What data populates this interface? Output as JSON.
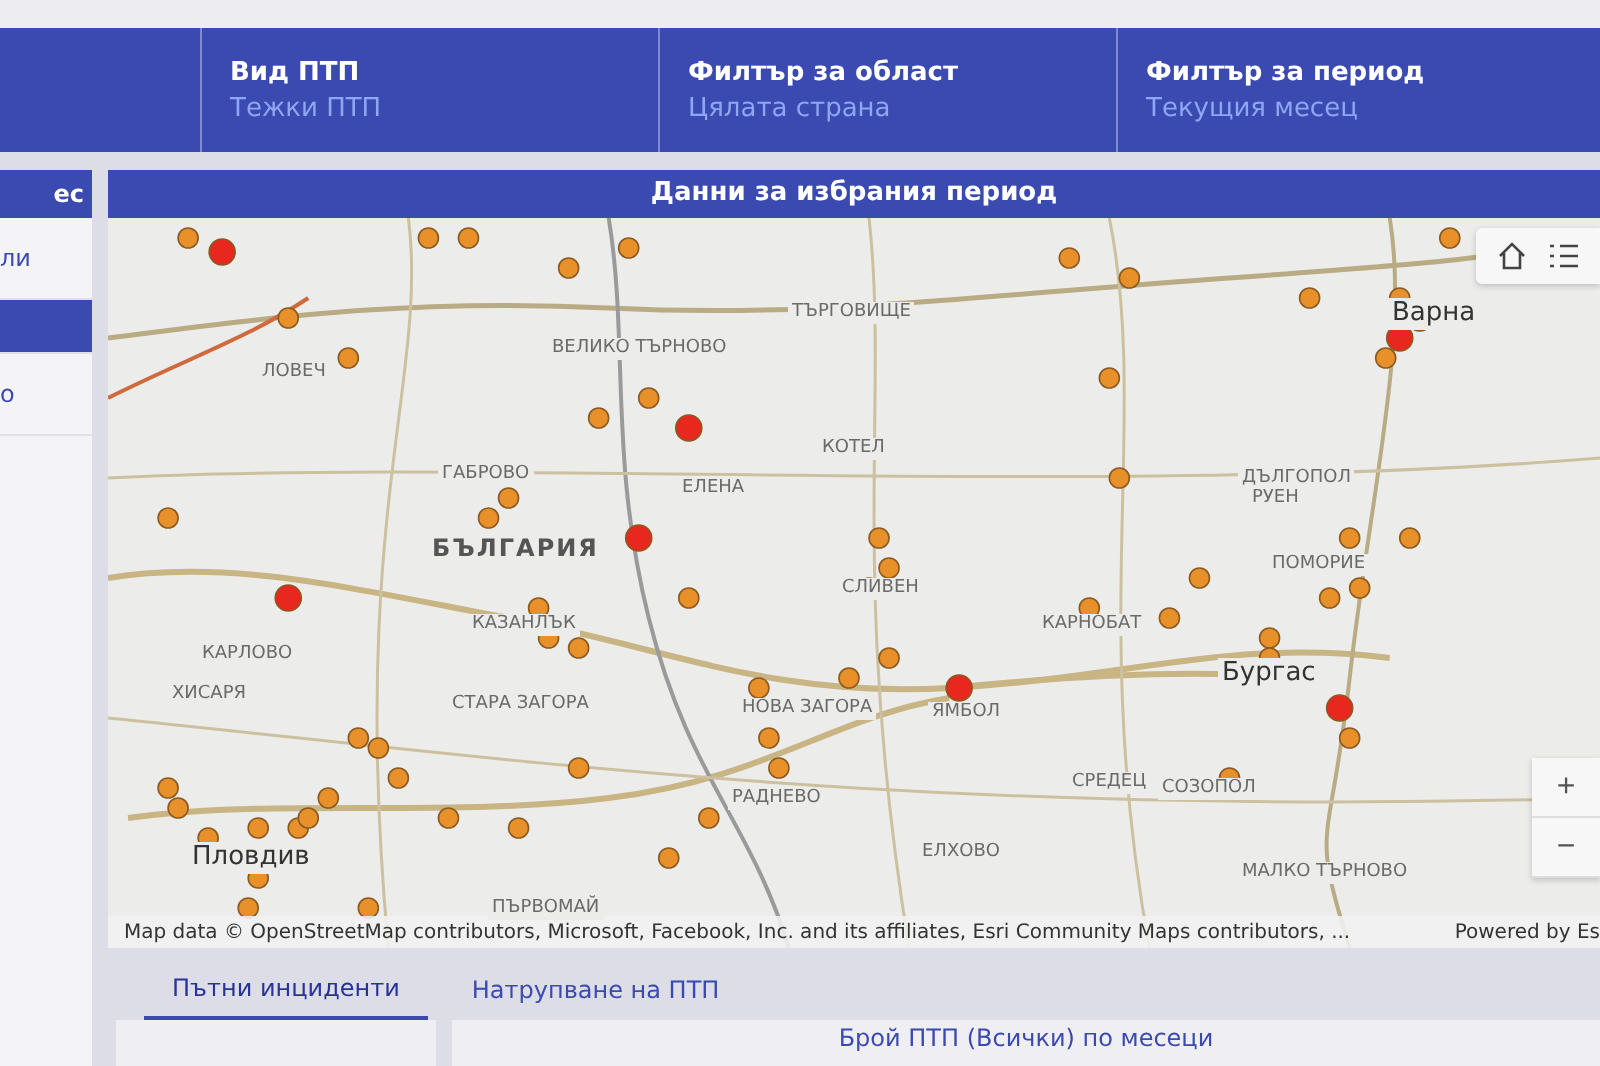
{
  "header": {
    "filters": [
      {
        "label": "Вид ПТП",
        "value": "Тежки ПТП"
      },
      {
        "label": "Филтър за област",
        "value": "Цялата страна"
      },
      {
        "label": "Филтър за период",
        "value": "Текущия месец"
      }
    ]
  },
  "side_panel": {
    "title": "ес",
    "items": [
      {
        "label": "ли",
        "selected": false
      },
      {
        "selected": true
      },
      {
        "label": "о",
        "selected": false
      }
    ]
  },
  "main_title": "Данни за избрания период",
  "map": {
    "labels": [
      {
        "text": "БЪЛГАРИЯ",
        "kind": "country"
      },
      {
        "text": "Варна",
        "kind": "city"
      },
      {
        "text": "Бургас",
        "kind": "city"
      },
      {
        "text": "Пловдив",
        "kind": "city"
      },
      {
        "text": "ВЕЛИКО ТЪРНОВО",
        "kind": "town"
      },
      {
        "text": "ТЪРГОВИЩЕ",
        "kind": "town"
      },
      {
        "text": "ЛОВЕЧ",
        "kind": "town"
      },
      {
        "text": "ГАБРОВО",
        "kind": "town"
      },
      {
        "text": "ЕЛЕНА",
        "kind": "town"
      },
      {
        "text": "КОТЕЛ",
        "kind": "town"
      },
      {
        "text": "ДЪЛГОПОЛ",
        "kind": "town"
      },
      {
        "text": "РУЕН",
        "kind": "town"
      },
      {
        "text": "КАРЛОВО",
        "kind": "town"
      },
      {
        "text": "КАЗАНЛЪК",
        "kind": "town"
      },
      {
        "text": "СЛИВЕН",
        "kind": "town"
      },
      {
        "text": "КАРНОБАТ",
        "kind": "town"
      },
      {
        "text": "ПОМОРИЕ",
        "kind": "town"
      },
      {
        "text": "ХИСАРЯ",
        "kind": "town"
      },
      {
        "text": "СТАРА ЗАГОРА",
        "kind": "town"
      },
      {
        "text": "НОВА ЗАГОРА",
        "kind": "town"
      },
      {
        "text": "ЯМБОЛ",
        "kind": "town"
      },
      {
        "text": "СРЕДЕЦ",
        "kind": "town"
      },
      {
        "text": "СОЗОПОЛ",
        "kind": "town"
      },
      {
        "text": "РАДНЕВО",
        "kind": "town"
      },
      {
        "text": "ЕЛХОВО",
        "kind": "town"
      },
      {
        "text": "МАЛКО ТЪРНОВО",
        "kind": "town"
      },
      {
        "text": "ПЪРВОМАЙ",
        "kind": "town"
      }
    ],
    "attribution": "Map data © OpenStreetMap contributors, Microsoft, Facebook, Inc. and its affiliates, Esri Community Maps contributors, ...",
    "powered_by": "Powered by Es",
    "zoom_in": "+",
    "zoom_out": "−"
  },
  "tabs": [
    {
      "label": "Пътни инциденти",
      "selected": true
    },
    {
      "label": "Натрупване на ПТП",
      "selected": false
    }
  ],
  "chart_title": "Брой ПТП (Всички) по месеци"
}
